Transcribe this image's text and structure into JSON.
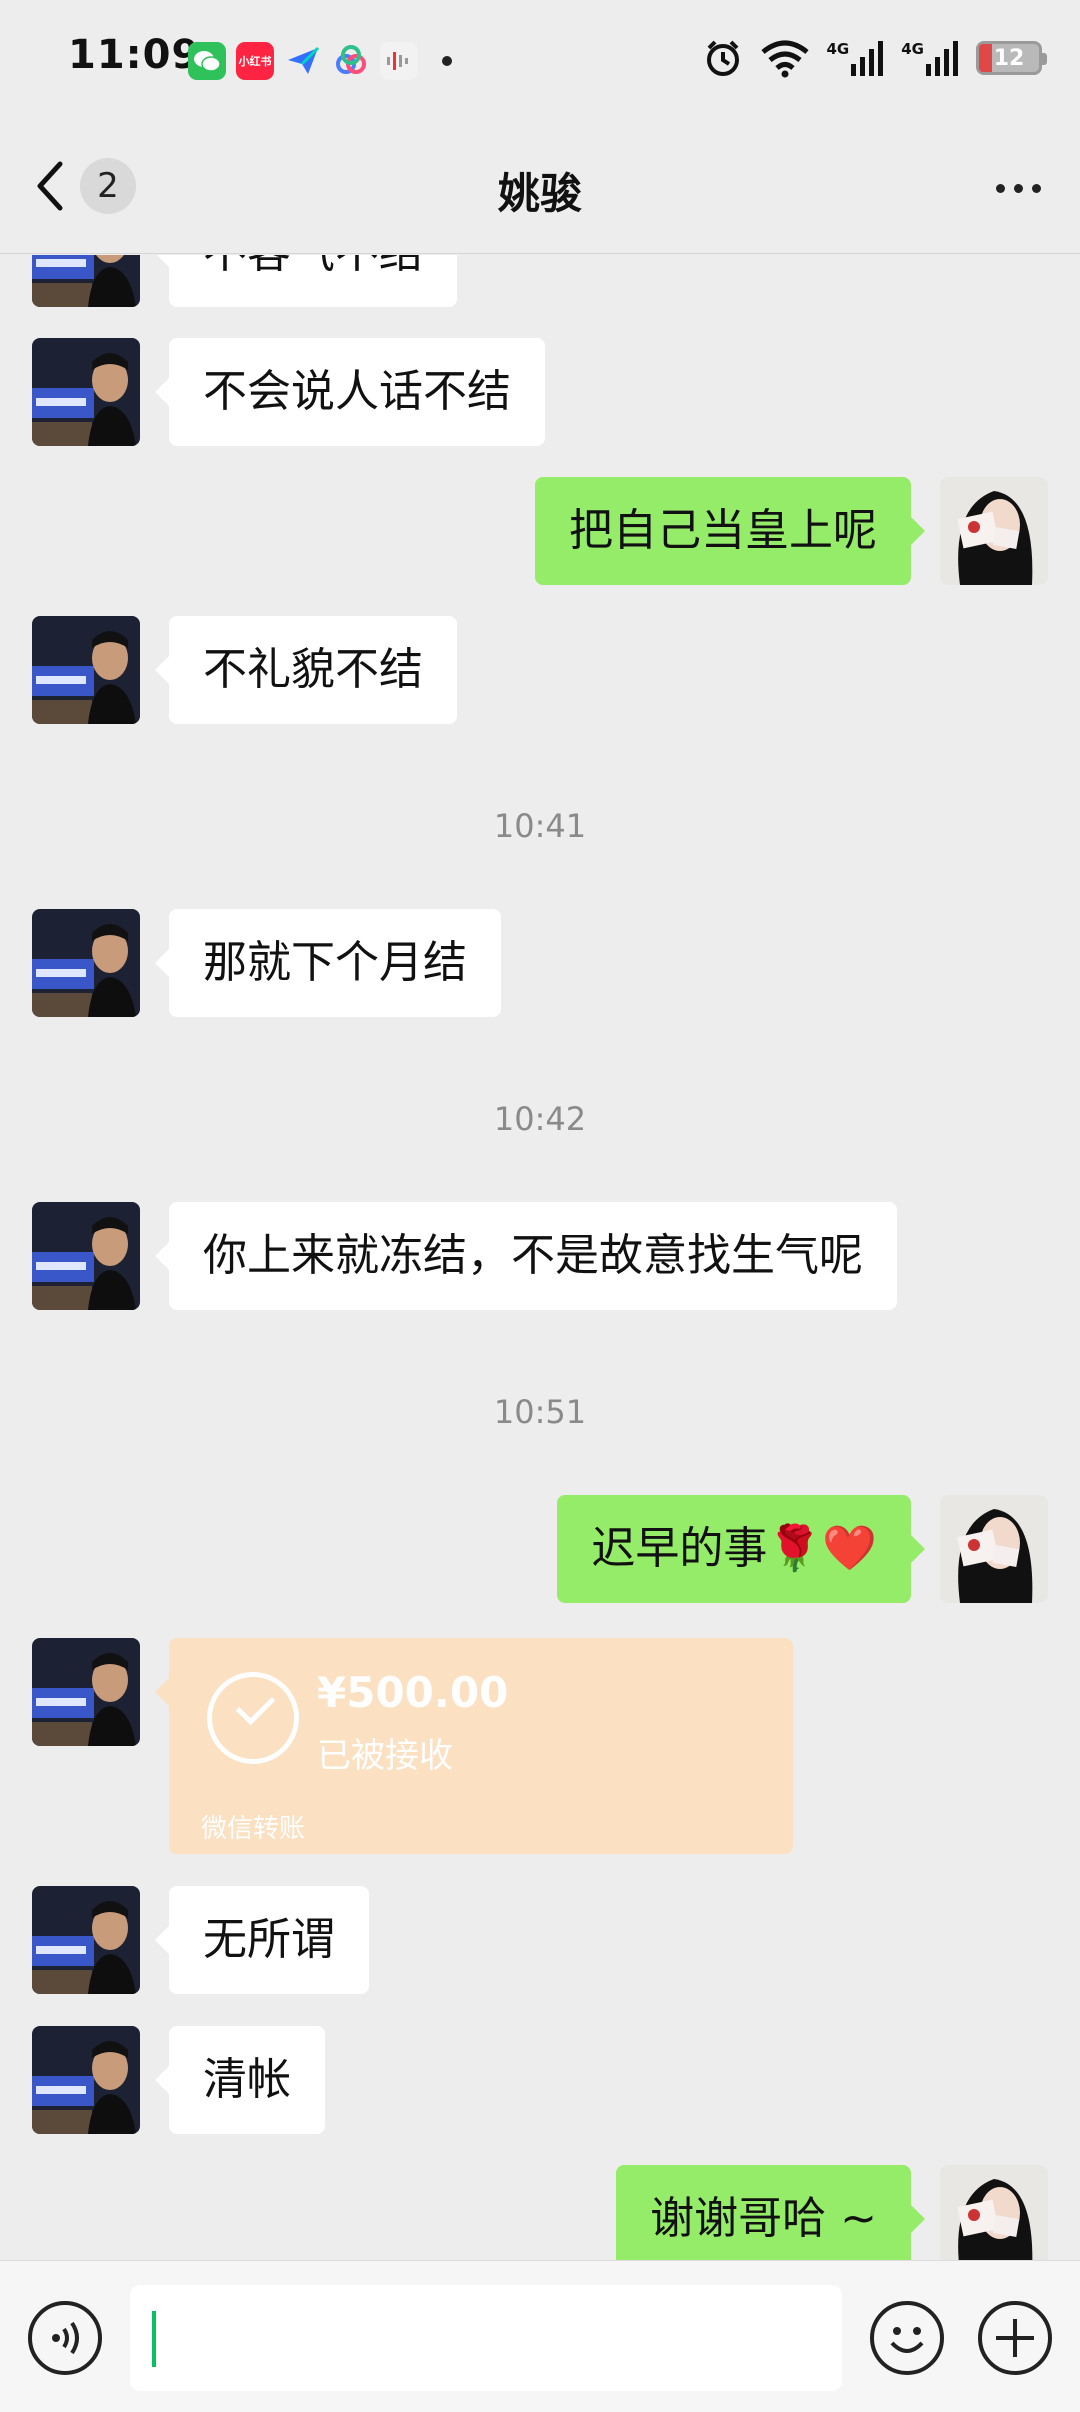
{
  "status": {
    "time": "11:09",
    "battery": "12",
    "apps": [
      "wechat-icon",
      "xiaohongshu-icon",
      "feishu-icon",
      "app-icon",
      "voice-app-icon"
    ],
    "xiaohongshu_label": "小红书",
    "network": "4G"
  },
  "header": {
    "title": "姚骏",
    "unread": "2"
  },
  "messages": [
    {
      "side": "left",
      "text": "不客气不结"
    },
    {
      "side": "left",
      "text": "不会说人话不结"
    },
    {
      "side": "right",
      "text": "把自己当皇上呢"
    },
    {
      "side": "left",
      "text": "不礼貌不结"
    },
    {
      "type": "time",
      "text": "10:41"
    },
    {
      "side": "left",
      "text": "那就下个月结"
    },
    {
      "type": "time",
      "text": "10:42"
    },
    {
      "side": "left",
      "text": "你上来就冻结，不是故意找生气呢"
    },
    {
      "type": "time",
      "text": "10:51"
    },
    {
      "side": "right",
      "text": "迟早的事🌹❤️"
    },
    {
      "side": "left",
      "type": "transfer",
      "amount": "¥500.00",
      "status": "已被接收",
      "footer": "微信转账"
    },
    {
      "side": "left",
      "text": "无所谓"
    },
    {
      "side": "left",
      "text": "清帐"
    },
    {
      "side": "right",
      "text": "谢谢哥哈 ~"
    }
  ],
  "input": {
    "placeholder": ""
  },
  "colors": {
    "background": "#ededed",
    "sent_bubble": "#95ec69",
    "received_bubble": "#ffffff",
    "transfer": "#fbe0c2",
    "cursor": "#07c160"
  }
}
